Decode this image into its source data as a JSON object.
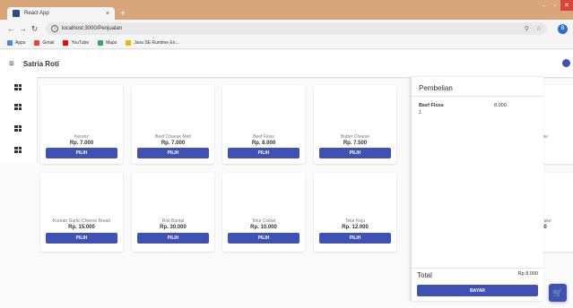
{
  "browser": {
    "tab_title": "React App",
    "tab_close": "×",
    "new_tab": "+",
    "url": "localhost:3000/Penjualan",
    "bookmarks": [
      {
        "label": "Apps",
        "color": "#4285f4"
      },
      {
        "label": "Gmail",
        "color": "#ea4335"
      },
      {
        "label": "YouTube",
        "color": "#ff0000"
      },
      {
        "label": "Maps",
        "color": "#34a853"
      },
      {
        "label": "Java SE Runtime En...",
        "color": "#f4b400"
      }
    ],
    "profile_initial": "B"
  },
  "app": {
    "brand": "Satria Roti",
    "accent": "#3f51b5"
  },
  "products": [
    {
      "name": "Keranz",
      "price": "Rp. 7.000",
      "button": "PILIH"
    },
    {
      "name": "Beef Cheese Melt",
      "price": "Rp. 7.000",
      "button": "PILIH"
    },
    {
      "name": "Beef Floss",
      "price": "Rp. 8.000",
      "button": "PILIH"
    },
    {
      "name": "Butter Cheese",
      "price": "Rp. 7.500",
      "button": "PILIH"
    },
    {
      "name": "Korean Garlic Cheese Bread",
      "price": "Rp. 15.000",
      "button": "PILIH"
    },
    {
      "name": "Roti Bantal",
      "price": "Rp. 30.000",
      "button": "PILIH"
    },
    {
      "name": "Telur Coklat",
      "price": "Rp. 10.000",
      "button": "PILIH"
    },
    {
      "name": "Telur Keju",
      "price": "Rp. 12.000",
      "button": "PILIH"
    }
  ],
  "hidden_cards": [
    {
      "name_fragment": "ese",
      "price_fragment": "0"
    },
    {
      "name_fragment": "Cake",
      "price_fragment": "00"
    }
  ],
  "cart": {
    "title": "Pembelian",
    "items": [
      {
        "name": "Beef Floss",
        "price": "8.000",
        "qty": "1"
      }
    ],
    "total_label": "Total",
    "total_value": "Rp 8.000",
    "checkout": "BAYAR"
  }
}
